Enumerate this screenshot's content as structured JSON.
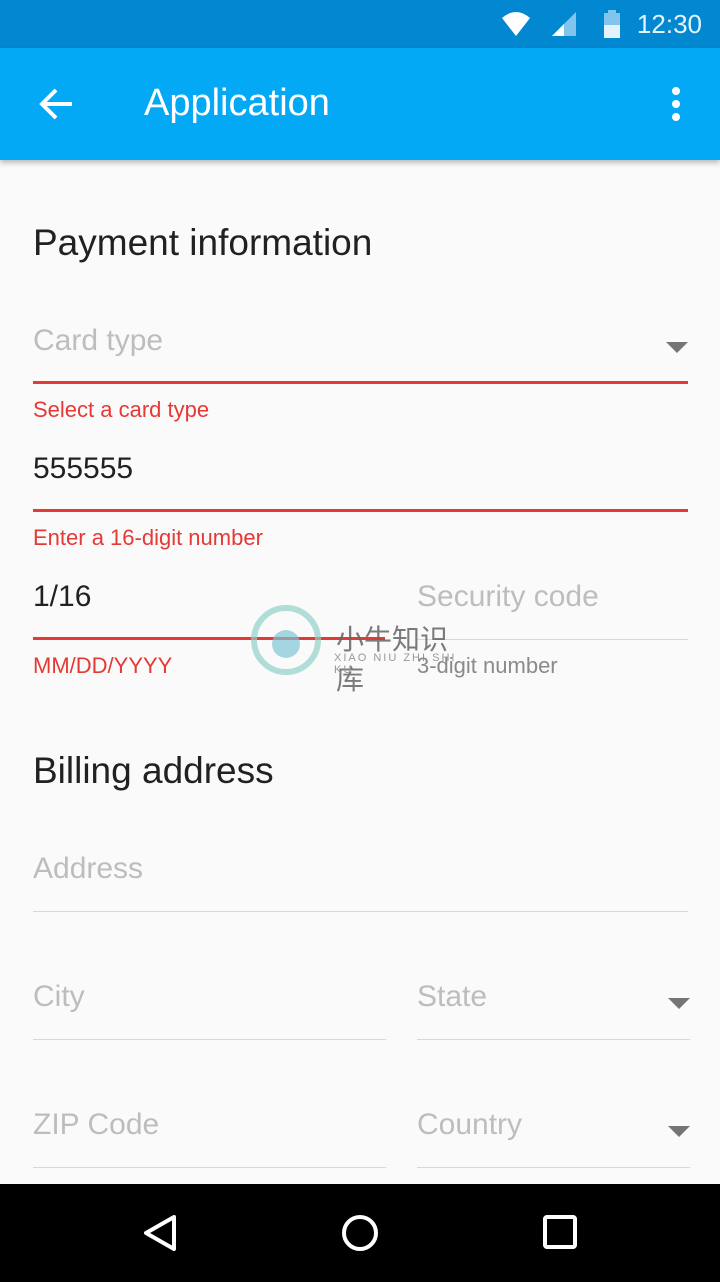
{
  "status_bar": {
    "time": "12:30",
    "icons": [
      "wifi-icon",
      "signal-icon",
      "battery-icon"
    ]
  },
  "app_bar": {
    "title": "Application",
    "back_icon": "arrow-left-icon",
    "menu_icon": "more-vertical-icon"
  },
  "payment": {
    "heading": "Payment information",
    "card_type": {
      "placeholder": "Card type",
      "error": "Select a card type"
    },
    "card_number": {
      "value": "555555",
      "error": "Enter a 16-digit number"
    },
    "expiry": {
      "value": "1/16",
      "error": "MM/DD/YYYY"
    },
    "security_code": {
      "placeholder": "Security code",
      "helper": "3-digit number"
    }
  },
  "billing": {
    "heading": "Billing address",
    "address": {
      "placeholder": "Address"
    },
    "city": {
      "placeholder": "City"
    },
    "state": {
      "placeholder": "State"
    },
    "zip": {
      "placeholder": "ZIP Code"
    },
    "country": {
      "placeholder": "Country"
    }
  },
  "watermark": {
    "text": "小牛知识库",
    "subtext": "XIAO NIU ZHI SHI KU"
  },
  "colors": {
    "primary": "#03a9f4",
    "primary_dark": "#0288d1",
    "error": "#e53935"
  }
}
